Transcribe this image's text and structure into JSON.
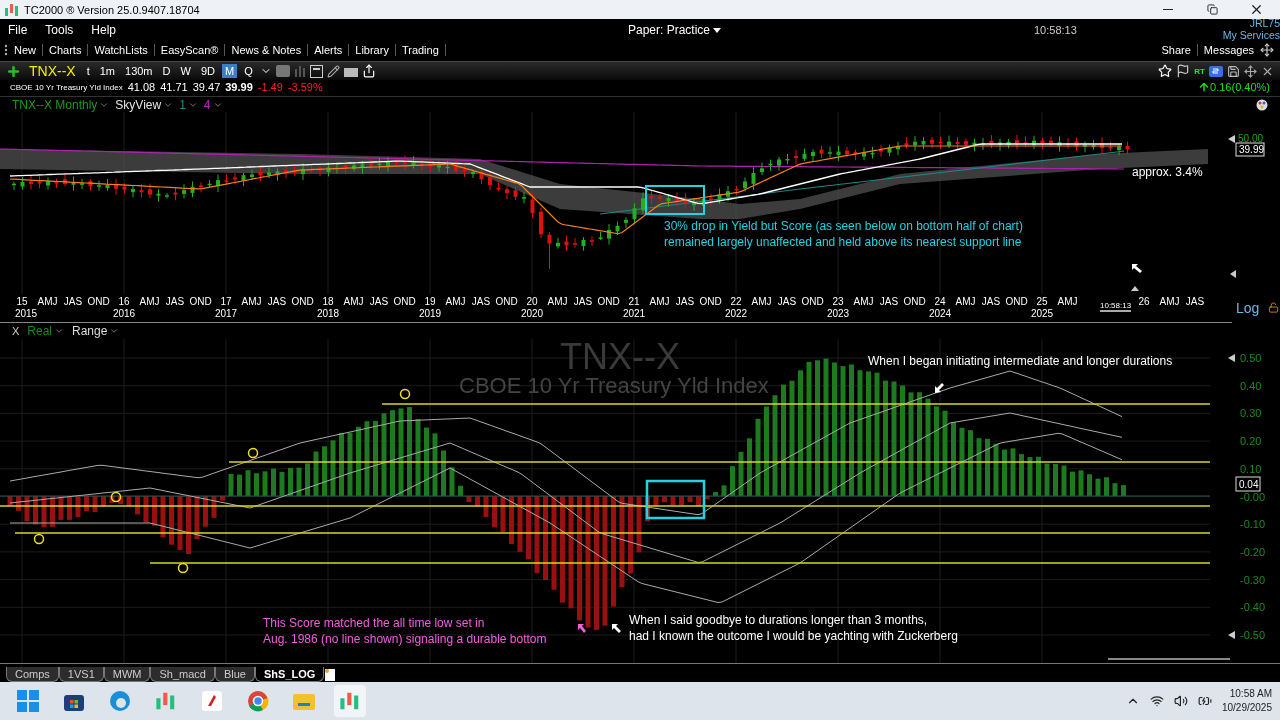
{
  "window": {
    "title": "TC2000 ® Version 25.0.9407.18704"
  },
  "menu": [
    "File",
    "Tools",
    "Help"
  ],
  "account": {
    "label": "Paper: Practice"
  },
  "clock": "10:58:13",
  "user": {
    "name": "JRL75",
    "link": "My Services"
  },
  "toolbar": {
    "items": [
      "New",
      "Charts",
      "WatchLists",
      "EasyScan®",
      "News & Notes",
      "Alerts",
      "Library",
      "Trading"
    ],
    "right": [
      "Share",
      "Messages"
    ]
  },
  "chart_toolbar": {
    "symbol": "TNX--X",
    "rt": "RT",
    "intervals": [
      {
        "label": "t",
        "selected": false
      },
      {
        "label": "1m",
        "selected": false
      },
      {
        "label": "130m",
        "selected": false
      },
      {
        "label": "D",
        "selected": false
      },
      {
        "label": "W",
        "selected": false
      },
      {
        "label": "9D",
        "selected": false
      },
      {
        "label": "M",
        "selected": true
      },
      {
        "label": "Q",
        "selected": false
      }
    ]
  },
  "quote": {
    "name": "CBOE 10 Yr Treasury Yld Index",
    "open": "41.08",
    "high": "41.71",
    "low": "39.47",
    "last": "39.99",
    "change": "-1.49",
    "change_pct": "-3.59%",
    "day_change": "0.16",
    "day_change_pct": "(0.40%)"
  },
  "price_pane": {
    "legend": [
      {
        "label": "TNX--X Monthly",
        "color": "#1a9a1a"
      },
      {
        "label": "SkyView",
        "color": "#e6e6e6"
      },
      {
        "label": "1",
        "color": "#1a8a8a"
      },
      {
        "label": "4",
        "color": "#c020c0"
      }
    ],
    "y_label": "50.00",
    "price_tag": "39.99",
    "annotations": [
      {
        "lines": [
          "approx. 3.4%"
        ],
        "color": "#ffffff"
      },
      {
        "lines": [
          "30% drop in Yield but Score (as seen below on bottom half of chart)",
          "remained largely unaffected and held above its nearest support line"
        ],
        "color": "#22d3e0"
      }
    ]
  },
  "time_axis": {
    "quarters": [
      "15",
      "AMJ",
      "JAS",
      "OND",
      "16",
      "AMJ",
      "JAS",
      "OND",
      "17",
      "AMJ",
      "JAS",
      "OND",
      "18",
      "AMJ",
      "JAS",
      "OND",
      "19",
      "AMJ",
      "JAS",
      "OND",
      "20",
      "AMJ",
      "JAS",
      "OND",
      "21",
      "AMJ",
      "JAS",
      "OND",
      "22",
      "AMJ",
      "JAS",
      "OND",
      "23",
      "AMJ",
      "JAS",
      "OND",
      "24",
      "AMJ",
      "JAS",
      "OND",
      "25",
      "AMJ",
      "26",
      "AMJ",
      "JAS"
    ],
    "years": [
      "2015",
      "2016",
      "2017",
      "2018",
      "2019",
      "2020",
      "2021",
      "2022",
      "2023",
      "2024",
      "2025"
    ],
    "clock": "10:58:13",
    "scale": "Log"
  },
  "score_pane": {
    "close": "X",
    "legend": [
      "Real",
      "Range"
    ],
    "watermark_symbol": "TNX--X",
    "watermark_name": "CBOE 10 Yr Treasury Yld Index",
    "y_labels": [
      "0.50",
      "0.40",
      "0.30",
      "0.20",
      "0.10",
      "-0.00",
      "-0.10",
      "-0.20",
      "-0.30",
      "-0.40",
      "-0.50"
    ],
    "value_tag": "0.04",
    "annotations": [
      {
        "lines": [
          "When I began initiating intermediate and longer durations"
        ],
        "color": "#ffffff"
      },
      {
        "lines": [
          "This Score matched the all time low set in",
          "Aug. 1986 (no line shown) signaling a durable bottom"
        ],
        "color": "#f060e0"
      },
      {
        "lines": [
          "When I said goodbye to durations longer than 3 months,",
          "had I known the outcome I would be yachting with Zuckerberg"
        ],
        "color": "#ffffff"
      }
    ]
  },
  "sheet_tabs": [
    {
      "label": "Comps",
      "selected": false
    },
    {
      "label": "1VS1",
      "selected": false
    },
    {
      "label": "MWM",
      "selected": false
    },
    {
      "label": "Sh_macd",
      "selected": false
    },
    {
      "label": "Blue",
      "selected": false
    },
    {
      "label": "ShS_LOG",
      "selected": true
    }
  ],
  "taskbar": {
    "time": "10:58 AM",
    "date": "10/29/2025"
  }
}
